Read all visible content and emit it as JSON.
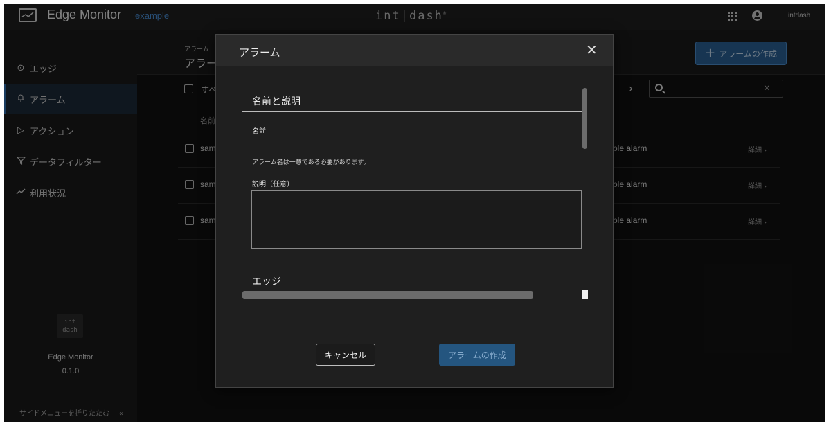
{
  "topbar": {
    "app_title": "Edge Monitor",
    "project": "example",
    "brand": "int",
    "brand_suffix": "dash",
    "brand_mark": "®",
    "user": "intdash",
    "icons": [
      "monitor-icon",
      "apps-grid-icon",
      "account-icon"
    ]
  },
  "sidebar": {
    "items": [
      {
        "label": "エッジ",
        "icon": "crosshair-icon"
      },
      {
        "label": "アラーム",
        "icon": "bell-icon",
        "active": true
      },
      {
        "label": "アクション",
        "icon": "play-icon"
      },
      {
        "label": "データフィルター",
        "icon": "filter-icon"
      },
      {
        "label": "利用状況",
        "icon": "trend-icon"
      }
    ],
    "logo": "int",
    "logo_suffix": "dash",
    "app_name": "Edge Monitor",
    "version": "0.1.0",
    "collapse_label": "サイドメニューを折りたたむ",
    "collapse_icon": "«"
  },
  "main": {
    "breadcrumb": "アラーム",
    "title": "アラー",
    "create_button": "アラームの作成",
    "select_all": "すべ",
    "column_name": "名前",
    "search": {
      "value": "",
      "clear": "×"
    },
    "next_icon": "›",
    "rows": [
      {
        "name": "sam",
        "desc": "ple alarm",
        "detail": "詳細 ›"
      },
      {
        "name": "sam",
        "desc": "ple alarm",
        "detail": "詳細 ›"
      },
      {
        "name": "sam",
        "desc": "ple alarm",
        "detail": "詳細 ›"
      }
    ]
  },
  "dialog": {
    "title": "アラーム",
    "close": "✕",
    "section_name_desc": "名前と説明",
    "name_label": "名前",
    "name_helper": "アラーム名は一意である必要があります。",
    "desc_label": "説明（任意）",
    "desc_value": "",
    "section_edge": "エッジ",
    "cancel": "キャンセル",
    "create": "アラームの作成"
  },
  "colors": {
    "accent": "#2a6196",
    "brand_link": "#4a8fd6",
    "background": "#121212",
    "dialog": "#1f1f1f"
  }
}
